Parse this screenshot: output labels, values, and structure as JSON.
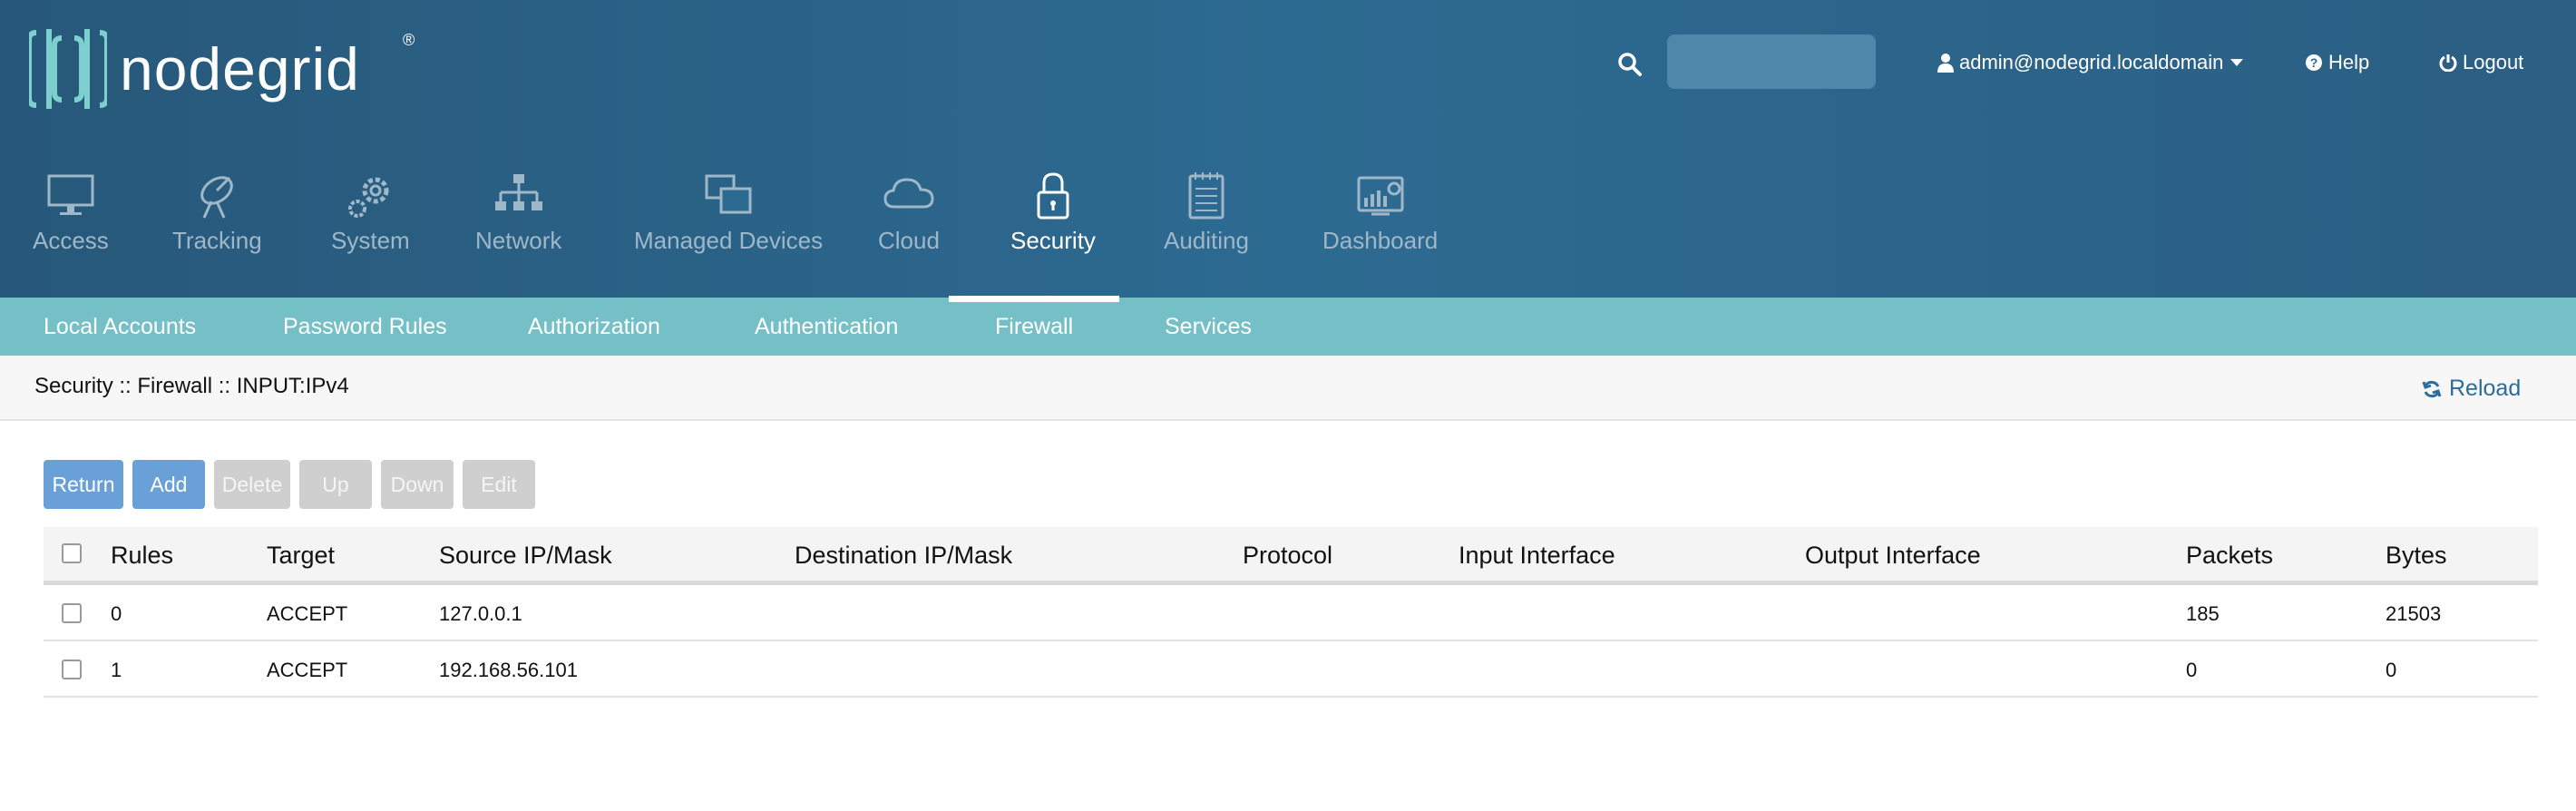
{
  "header": {
    "logo_text": "nodegrid",
    "search": {
      "placeholder": "",
      "value": ""
    },
    "user_label": "admin@nodegrid.localdomain",
    "help_label": "Help",
    "logout_label": "Logout"
  },
  "main_nav": [
    {
      "label": "Access",
      "icon": "monitor-icon"
    },
    {
      "label": "Tracking",
      "icon": "satellite-dish-icon"
    },
    {
      "label": "System",
      "icon": "gears-icon"
    },
    {
      "label": "Network",
      "icon": "network-tree-icon"
    },
    {
      "label": "Managed Devices",
      "icon": "windows-icon"
    },
    {
      "label": "Cloud",
      "icon": "cloud-icon"
    },
    {
      "label": "Security",
      "icon": "lock-icon",
      "active": true
    },
    {
      "label": "Auditing",
      "icon": "notepad-icon"
    },
    {
      "label": "Dashboard",
      "icon": "dashboard-chart-icon"
    }
  ],
  "sub_nav": [
    {
      "label": "Local Accounts"
    },
    {
      "label": "Password Rules"
    },
    {
      "label": "Authorization"
    },
    {
      "label": "Authentication"
    },
    {
      "label": "Firewall",
      "active": true
    },
    {
      "label": "Services"
    }
  ],
  "breadcrumb": "Security :: Firewall :: INPUT:IPv4",
  "reload_label": "Reload",
  "toolbar": {
    "return_label": "Return",
    "add_label": "Add",
    "delete_label": "Delete",
    "up_label": "Up",
    "down_label": "Down",
    "edit_label": "Edit"
  },
  "table": {
    "columns": [
      "Rules",
      "Target",
      "Source IP/Mask",
      "Destination IP/Mask",
      "Protocol",
      "Input Interface",
      "Output Interface",
      "Packets",
      "Bytes"
    ],
    "rows": [
      {
        "rule": "0",
        "target": "ACCEPT",
        "source": "127.0.0.1",
        "destination": "",
        "protocol": "",
        "input_interface": "",
        "output_interface": "",
        "packets": "185",
        "bytes": "21503"
      },
      {
        "rule": "1",
        "target": "ACCEPT",
        "source": "192.168.56.101",
        "destination": "",
        "protocol": "",
        "input_interface": "",
        "output_interface": "",
        "packets": "0",
        "bytes": "0"
      }
    ]
  },
  "colors": {
    "header_bg": "#2d6a91",
    "subnav_bg": "#75c0c6",
    "primary_button": "#6aa0d8",
    "disabled_button": "#cfcfcf",
    "reload_link": "#2b6d9a"
  }
}
